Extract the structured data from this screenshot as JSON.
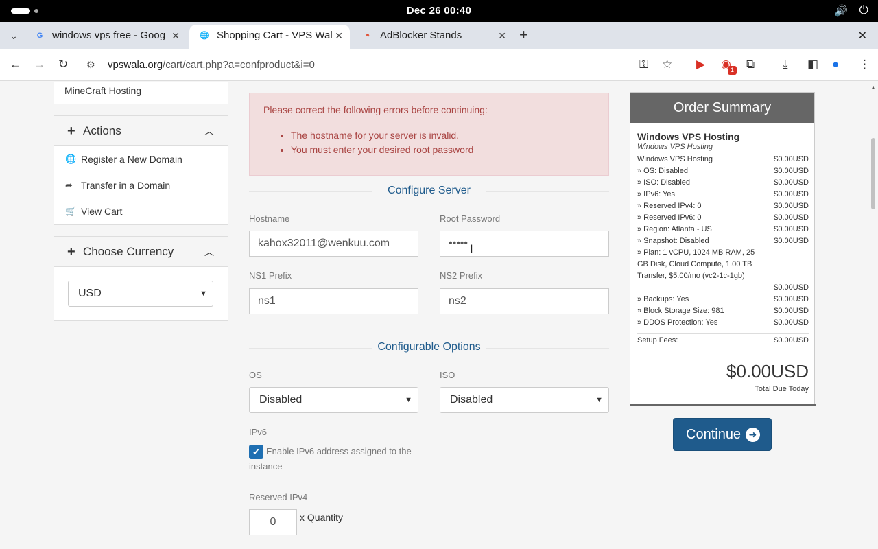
{
  "system": {
    "clock": "Dec 26  00:40"
  },
  "browser": {
    "tabs": [
      {
        "title": "windows vps free - Goog",
        "favicon": "G",
        "active": false
      },
      {
        "title": "Shopping Cart - VPS Wal",
        "favicon": "globe",
        "active": true
      },
      {
        "title": "AdBlocker Stands",
        "favicon": "rainbow",
        "active": false
      }
    ],
    "url_host": "vpswala.org",
    "url_path": "/cart/cart.php?a=confproduct&i=0",
    "extension_badge": "1"
  },
  "sidebar": {
    "top_item": "MineCraft Hosting",
    "actions_title": "Actions",
    "actions": [
      {
        "label": "Register a New Domain",
        "icon": "globe-icon"
      },
      {
        "label": "Transfer in a Domain",
        "icon": "share-arrow-icon"
      },
      {
        "label": "View Cart",
        "icon": "cart-icon"
      }
    ],
    "currency_title": "Choose Currency",
    "currency_value": "USD"
  },
  "alert": {
    "title": "Please correct the following errors before continuing:",
    "errors": [
      "The hostname for your server is invalid.",
      "You must enter your desired root password"
    ]
  },
  "configure_server": {
    "title": "Configure Server",
    "hostname_label": "Hostname",
    "hostname_value": "kahox32011@wenkuu.com",
    "root_password_label": "Root Password",
    "root_password_value": "•••••",
    "ns1_label": "NS1 Prefix",
    "ns1_value": "ns1",
    "ns2_label": "NS2 Prefix",
    "ns2_value": "ns2"
  },
  "configurable_options": {
    "title": "Configurable Options",
    "os_label": "OS",
    "os_value": "Disabled",
    "iso_label": "ISO",
    "iso_value": "Disabled",
    "ipv6_label": "IPv6",
    "ipv6_checkbox_label": "Enable IPv6 address assigned to the instance",
    "ipv6_checked": true,
    "reserved_ipv4_label": "Reserved IPv4",
    "reserved_ipv4_value": "0",
    "quantity_label": "x Quantity"
  },
  "order_summary": {
    "title": "Order Summary",
    "product": "Windows VPS Hosting",
    "group": "Windows VPS Hosting",
    "rows": [
      {
        "label": "Windows VPS Hosting",
        "amount": "$0.00USD"
      },
      {
        "label": " » OS: Disabled",
        "amount": "$0.00USD"
      },
      {
        "label": " » ISO: Disabled",
        "amount": "$0.00USD"
      },
      {
        "label": " » IPv6: Yes",
        "amount": "$0.00USD"
      },
      {
        "label": " » Reserved IPv4: 0",
        "amount": "$0.00USD"
      },
      {
        "label": " » Reserved IPv6: 0",
        "amount": "$0.00USD"
      },
      {
        "label": " » Region: Atlanta - US",
        "amount": "$0.00USD"
      },
      {
        "label": " » Snapshot: Disabled",
        "amount": "$0.00USD"
      }
    ],
    "plan_text": " » Plan: 1 vCPU, 1024 MB RAM, 25 GB Disk, Cloud Compute, 1.00 TB Transfer, $5.00/mo (vc2-1c-1gb)",
    "plan_amount": "$0.00USD",
    "rows2": [
      {
        "label": " » Backups: Yes",
        "amount": "$0.00USD"
      },
      {
        "label": " » Block Storage Size: 981",
        "amount": "$0.00USD"
      },
      {
        "label": " » DDOS Protection: Yes",
        "amount": "$0.00USD"
      }
    ],
    "setup_fees_label": "Setup Fees:",
    "setup_fees_amount": "$0.00USD",
    "total": "$0.00USD",
    "total_label": "Total Due Today"
  },
  "continue_label": "Continue"
}
